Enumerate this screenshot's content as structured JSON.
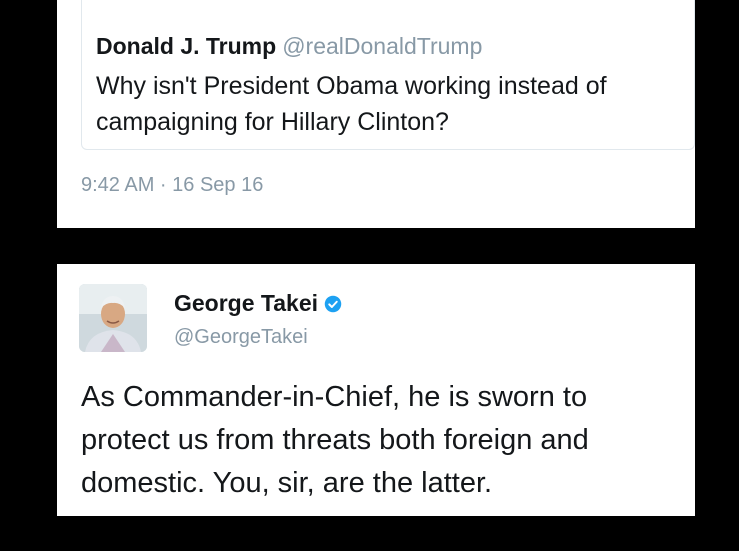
{
  "quoted_tweet": {
    "name": "Donald J. Trump",
    "handle": "@realDonaldTrump",
    "text": "Why isn't President Obama working instead of campaigning for Hillary Clinton?",
    "timestamp": "9:42 AM · 16 Sep 16"
  },
  "reply_tweet": {
    "name": "George Takei",
    "handle": "@GeorgeTakei",
    "verified": true,
    "text": "As Commander-in-Chief, he is sworn to protect us from threats both foreign and domestic. You, sir, are the latter."
  },
  "colors": {
    "background": "#000000",
    "card": "#ffffff",
    "text": "#14171a",
    "muted": "#8899a6",
    "verified": "#1da1f2"
  }
}
